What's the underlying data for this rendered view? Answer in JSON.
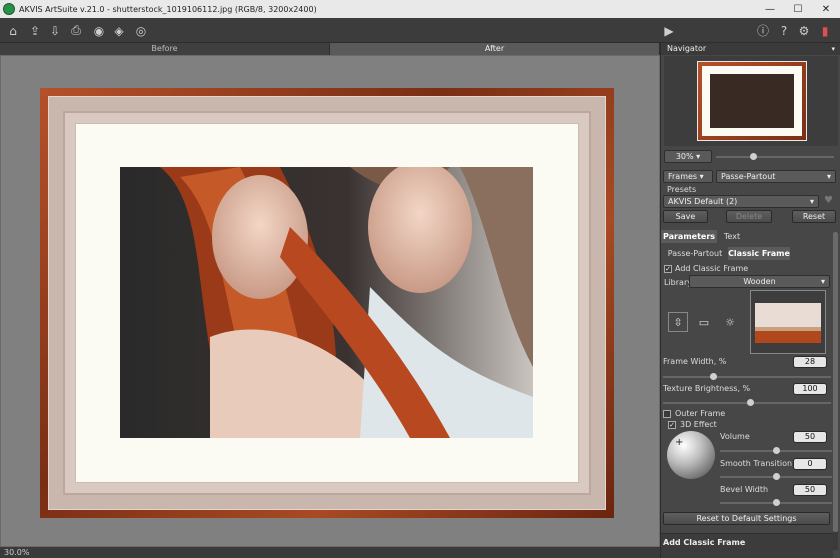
{
  "window": {
    "title": "AKVIS ArtSuite v.21.0 - shutterstock_1019106112.jpg (RGB/8, 3200x2400)",
    "minimize": "—",
    "maximize": "☐",
    "close": "✕"
  },
  "toolbar": {
    "icons": [
      "home-icon",
      "open-icon",
      "save-icon",
      "print-icon",
      "share-icon",
      "batch-icon",
      "plugin-icon"
    ],
    "right_icons": [
      "run-icon",
      "info-icon",
      "help-icon",
      "settings-icon",
      "notify-icon"
    ]
  },
  "view_tabs": {
    "before": "Before",
    "after": "After"
  },
  "status": {
    "zoom": "30.0%"
  },
  "navigator": {
    "title": "Navigator",
    "zoom": "30%"
  },
  "mode": {
    "effect": "Frames",
    "style": "Passe-Partout"
  },
  "presets": {
    "label": "Presets",
    "current": "AKVIS Default (2)",
    "save": "Save",
    "delete": "Delete",
    "reset": "Reset"
  },
  "param_tabs": {
    "parameters": "Parameters",
    "text": "Text"
  },
  "sub_tabs": {
    "passe_partout": "Passe-Partout",
    "classic_frame": "Classic Frame"
  },
  "classic": {
    "add_label": "Add Classic Frame",
    "library_label": "Library",
    "library_value": "Wooden",
    "frame_width_label": "Frame Width, %",
    "frame_width": "28",
    "frame_width_level": 0.28,
    "texture_label": "Texture Brightness, %",
    "texture": "100",
    "texture_level": 0.5,
    "outer_frame_label": "Outer Frame",
    "effect3d_label": "3D Effect",
    "volume_label": "Volume",
    "volume": "50",
    "smooth_label": "Smooth Transition",
    "smooth": "0",
    "bevel_label": "Bevel Width",
    "bevel": "50",
    "reset_defaults": "Reset to Default Settings"
  },
  "hint": {
    "title": "Add Classic Frame"
  }
}
